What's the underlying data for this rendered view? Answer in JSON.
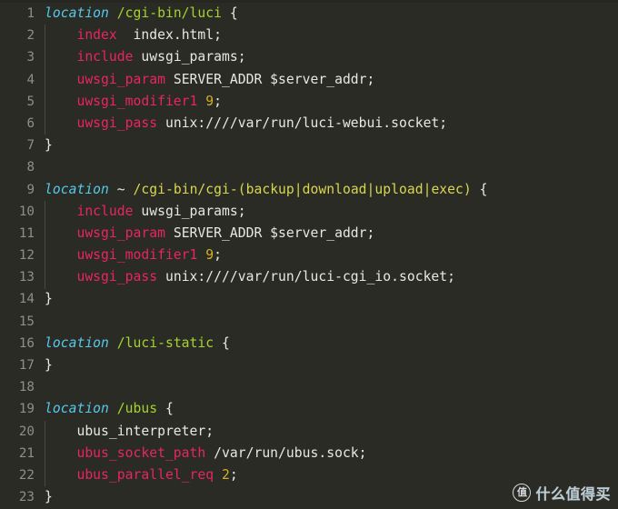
{
  "editor": {
    "language": "nginx",
    "background_color": "#2b2b26",
    "gutter_color": "#8f8f85",
    "default_text_color": "#e8e8e3",
    "colors": {
      "keyword": "#56c8e8",
      "uri": "#a6d22e",
      "regex": "#d7d74e",
      "directive": "#e9255f",
      "value": "#e8e8e3",
      "number": "#d2b024",
      "brace": "#e8e8e3",
      "indent_guide": "#4a4a42"
    },
    "lines": [
      {
        "n": "1",
        "indent": 0,
        "guide": false,
        "tokens": [
          {
            "t": "kw",
            "s": "location"
          },
          {
            "t": "plain",
            "s": " "
          },
          {
            "t": "uri",
            "s": "/cgi-bin/luci"
          },
          {
            "t": "plain",
            "s": " "
          },
          {
            "t": "brace",
            "s": "{"
          }
        ]
      },
      {
        "n": "2",
        "indent": 1,
        "guide": true,
        "tokens": [
          {
            "t": "dir",
            "s": "index"
          },
          {
            "t": "plain",
            "s": "  "
          },
          {
            "t": "val",
            "s": "index.html;"
          }
        ]
      },
      {
        "n": "3",
        "indent": 1,
        "guide": true,
        "tokens": [
          {
            "t": "dir",
            "s": "include"
          },
          {
            "t": "plain",
            "s": " "
          },
          {
            "t": "val",
            "s": "uwsgi_params;"
          }
        ]
      },
      {
        "n": "4",
        "indent": 1,
        "guide": true,
        "tokens": [
          {
            "t": "dir",
            "s": "uwsgi_param"
          },
          {
            "t": "plain",
            "s": " "
          },
          {
            "t": "val",
            "s": "SERVER_ADDR $server_addr;"
          }
        ]
      },
      {
        "n": "5",
        "indent": 1,
        "guide": true,
        "tokens": [
          {
            "t": "dir",
            "s": "uwsgi_modifier1"
          },
          {
            "t": "plain",
            "s": " "
          },
          {
            "t": "num",
            "s": "9"
          },
          {
            "t": "val",
            "s": ";"
          }
        ]
      },
      {
        "n": "6",
        "indent": 1,
        "guide": true,
        "tokens": [
          {
            "t": "dir",
            "s": "uwsgi_pass"
          },
          {
            "t": "plain",
            "s": " "
          },
          {
            "t": "val",
            "s": "unix:////var/run/luci-webui.socket;"
          }
        ]
      },
      {
        "n": "7",
        "indent": 0,
        "guide": false,
        "tokens": [
          {
            "t": "brace",
            "s": "}"
          }
        ]
      },
      {
        "n": "8",
        "indent": 0,
        "guide": false,
        "tokens": []
      },
      {
        "n": "9",
        "indent": 0,
        "guide": false,
        "tokens": [
          {
            "t": "kw",
            "s": "location"
          },
          {
            "t": "plain",
            "s": " "
          },
          {
            "t": "op",
            "s": "~"
          },
          {
            "t": "plain",
            "s": " "
          },
          {
            "t": "regex",
            "s": "/cgi-bin/cgi-(backup|download|upload|exec)"
          },
          {
            "t": "plain",
            "s": " "
          },
          {
            "t": "brace",
            "s": "{"
          }
        ]
      },
      {
        "n": "10",
        "indent": 1,
        "guide": true,
        "tokens": [
          {
            "t": "dir",
            "s": "include"
          },
          {
            "t": "plain",
            "s": " "
          },
          {
            "t": "val",
            "s": "uwsgi_params;"
          }
        ]
      },
      {
        "n": "11",
        "indent": 1,
        "guide": true,
        "tokens": [
          {
            "t": "dir",
            "s": "uwsgi_param"
          },
          {
            "t": "plain",
            "s": " "
          },
          {
            "t": "val",
            "s": "SERVER_ADDR $server_addr;"
          }
        ]
      },
      {
        "n": "12",
        "indent": 1,
        "guide": true,
        "tokens": [
          {
            "t": "dir",
            "s": "uwsgi_modifier1"
          },
          {
            "t": "plain",
            "s": " "
          },
          {
            "t": "num",
            "s": "9"
          },
          {
            "t": "val",
            "s": ";"
          }
        ]
      },
      {
        "n": "13",
        "indent": 1,
        "guide": true,
        "tokens": [
          {
            "t": "dir",
            "s": "uwsgi_pass"
          },
          {
            "t": "plain",
            "s": " "
          },
          {
            "t": "val",
            "s": "unix:////var/run/luci-cgi_io.socket;"
          }
        ]
      },
      {
        "n": "14",
        "indent": 0,
        "guide": false,
        "tokens": [
          {
            "t": "brace",
            "s": "}"
          }
        ]
      },
      {
        "n": "15",
        "indent": 0,
        "guide": false,
        "tokens": []
      },
      {
        "n": "16",
        "indent": 0,
        "guide": false,
        "tokens": [
          {
            "t": "kw",
            "s": "location"
          },
          {
            "t": "plain",
            "s": " "
          },
          {
            "t": "uri",
            "s": "/luci-static"
          },
          {
            "t": "plain",
            "s": " "
          },
          {
            "t": "brace",
            "s": "{"
          }
        ]
      },
      {
        "n": "17",
        "indent": 0,
        "guide": false,
        "tokens": [
          {
            "t": "brace",
            "s": "}"
          }
        ]
      },
      {
        "n": "18",
        "indent": 0,
        "guide": false,
        "tokens": []
      },
      {
        "n": "19",
        "indent": 0,
        "guide": false,
        "tokens": [
          {
            "t": "kw",
            "s": "location"
          },
          {
            "t": "plain",
            "s": " "
          },
          {
            "t": "uri",
            "s": "/ubus"
          },
          {
            "t": "plain",
            "s": " "
          },
          {
            "t": "brace",
            "s": "{"
          }
        ]
      },
      {
        "n": "20",
        "indent": 1,
        "guide": true,
        "tokens": [
          {
            "t": "val",
            "s": "ubus_interpreter;"
          }
        ]
      },
      {
        "n": "21",
        "indent": 1,
        "guide": true,
        "tokens": [
          {
            "t": "dir",
            "s": "ubus_socket_path"
          },
          {
            "t": "plain",
            "s": " "
          },
          {
            "t": "val",
            "s": "/var/run/ubus.sock;"
          }
        ]
      },
      {
        "n": "22",
        "indent": 1,
        "guide": true,
        "tokens": [
          {
            "t": "dir",
            "s": "ubus_parallel_req"
          },
          {
            "t": "plain",
            "s": " "
          },
          {
            "t": "num",
            "s": "2"
          },
          {
            "t": "val",
            "s": ";"
          }
        ]
      },
      {
        "n": "23",
        "indent": 0,
        "guide": false,
        "tokens": [
          {
            "t": "brace",
            "s": "}"
          }
        ]
      }
    ]
  },
  "watermark": {
    "logo_glyph": "值",
    "text": "什么值得买",
    "color": "#cfe4ee"
  }
}
